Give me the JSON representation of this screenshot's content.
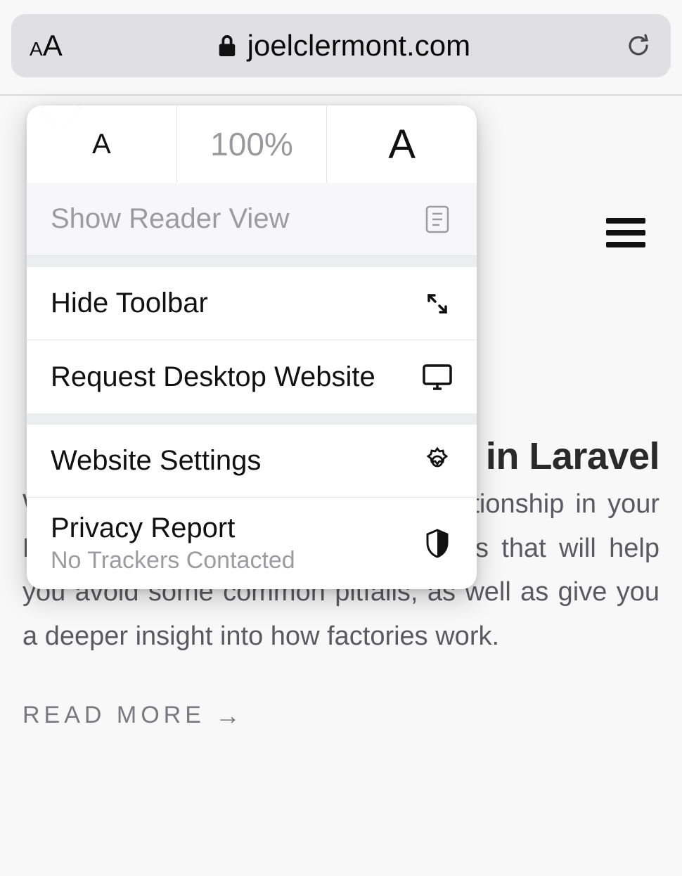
{
  "address_bar": {
    "url": "joelclermont.com"
  },
  "menu": {
    "zoom_percent": "100%",
    "reader_label": "Show Reader View",
    "hide_toolbar_label": "Hide Toolbar",
    "request_desktop_label": "Request Desktop Website",
    "website_settings_label": "Website Settings",
    "privacy_label": "Privacy Report",
    "privacy_sub": "No Trackers Contacted"
  },
  "page": {
    "title_fragment": "s in Laravel",
    "body": "What's the best way to define a relationship in your Laravel factories? I'll share some tips that will help you avoid some common pitfalls, as well as give you a deeper insight into how factories work.",
    "read_more": "READ MORE"
  }
}
